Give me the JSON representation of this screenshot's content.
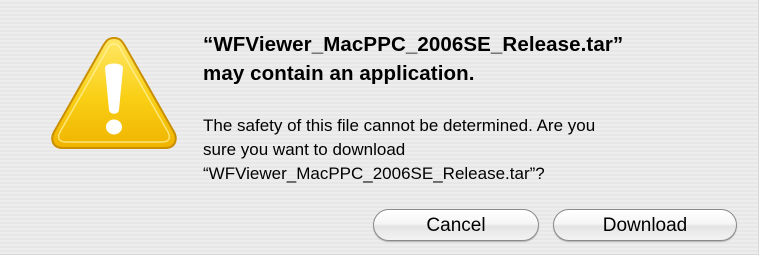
{
  "dialog": {
    "icon": "warning-triangle-icon",
    "icon_color": "#f7c600",
    "title": "“WFViewer_MacPPC_2006SE_Release.tar”\nmay contain an application.",
    "message": "The safety of this file cannot be determined. Are you\nsure you want to download\n“WFViewer_MacPPC_2006SE_Release.tar”?",
    "buttons": {
      "cancel_label": "Cancel",
      "download_label": "Download"
    }
  }
}
